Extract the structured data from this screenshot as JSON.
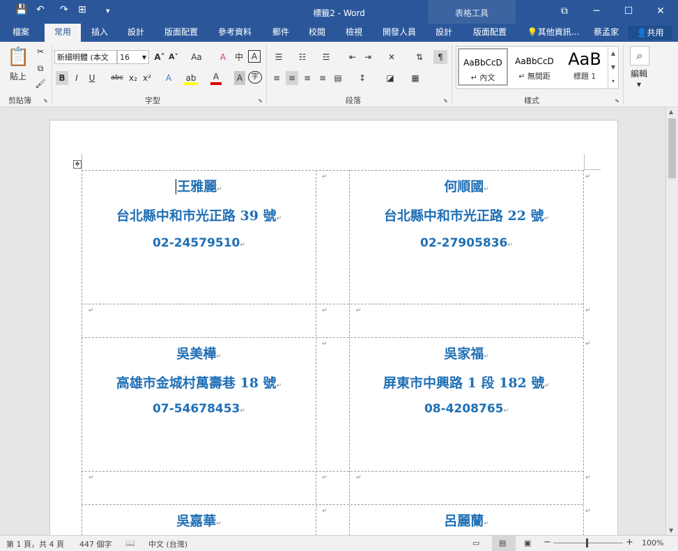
{
  "window": {
    "title": "標籤2 - Word",
    "tools_label": "表格工具",
    "minimize": "─",
    "restore": "☐",
    "close": "✕",
    "ribbon_display": "⧉"
  },
  "quick_access": {
    "save": "💾",
    "undo": "↶",
    "redo": "↷",
    "table": "⊞",
    "more": "▾"
  },
  "tabs": [
    {
      "label": "檔案"
    },
    {
      "label": "常用"
    },
    {
      "label": "插入"
    },
    {
      "label": "設計"
    },
    {
      "label": "版面配置"
    },
    {
      "label": "參考資料"
    },
    {
      "label": "郵件"
    },
    {
      "label": "校閱"
    },
    {
      "label": "檢視"
    },
    {
      "label": "開發人員"
    },
    {
      "label": "設計"
    },
    {
      "label": "版面配置"
    }
  ],
  "tell_me": "其他資訊...",
  "user": "蔡孟家",
  "share": "共用",
  "ribbon": {
    "paste": "貼上",
    "clipboard_label": "剪貼簿",
    "font_name": "新細明體 (本文",
    "font_size": "16",
    "font_label": "字型",
    "paragraph_label": "段落",
    "styles_label": "樣式",
    "editing": "編輯",
    "styles": [
      {
        "sample": "AaBbCcD",
        "name": "↵ 內文"
      },
      {
        "sample": "AaBbCcD",
        "name": "↵ 無間距"
      },
      {
        "sample": "AaB",
        "name": "標題 1"
      }
    ],
    "buttons": {
      "bold": "B",
      "italic": "I",
      "underline": "U",
      "strike": "abc",
      "sub": "x₂",
      "sup": "x²",
      "grow": "A˄",
      "shrink": "A˅",
      "case": "Aa",
      "clear": "A",
      "phonetic": "中",
      "border_char": "A",
      "effects": "A",
      "highlight": "ab",
      "font_color": "A",
      "shade": "A",
      "enclose": "字"
    }
  },
  "labels": [
    {
      "name": "王雅麗",
      "address": "台北縣中和市光正路 39 號",
      "phone": "02-24579510"
    },
    {
      "name": "何順國",
      "address": "台北縣中和市光正路 22 號",
      "phone": "02-27905836"
    },
    {
      "name": "吳美樺",
      "address": "高雄市金城村萬壽巷 18 號",
      "phone": "07-54678453"
    },
    {
      "name": "吳家福",
      "address": "屏東市中興路 1 段 182 號",
      "phone": "08-4208765"
    },
    {
      "name": "吳嘉華",
      "address": "",
      "phone": ""
    },
    {
      "name": "呂麗蘭",
      "address": "",
      "phone": ""
    }
  ],
  "paragraph_mark": "↵",
  "status": {
    "page": "第 1 頁，共 4 頁",
    "words": "447 個字",
    "language": "中文 (台灣)",
    "zoom": "100%",
    "zoom_out": "−",
    "zoom_in": "+"
  }
}
